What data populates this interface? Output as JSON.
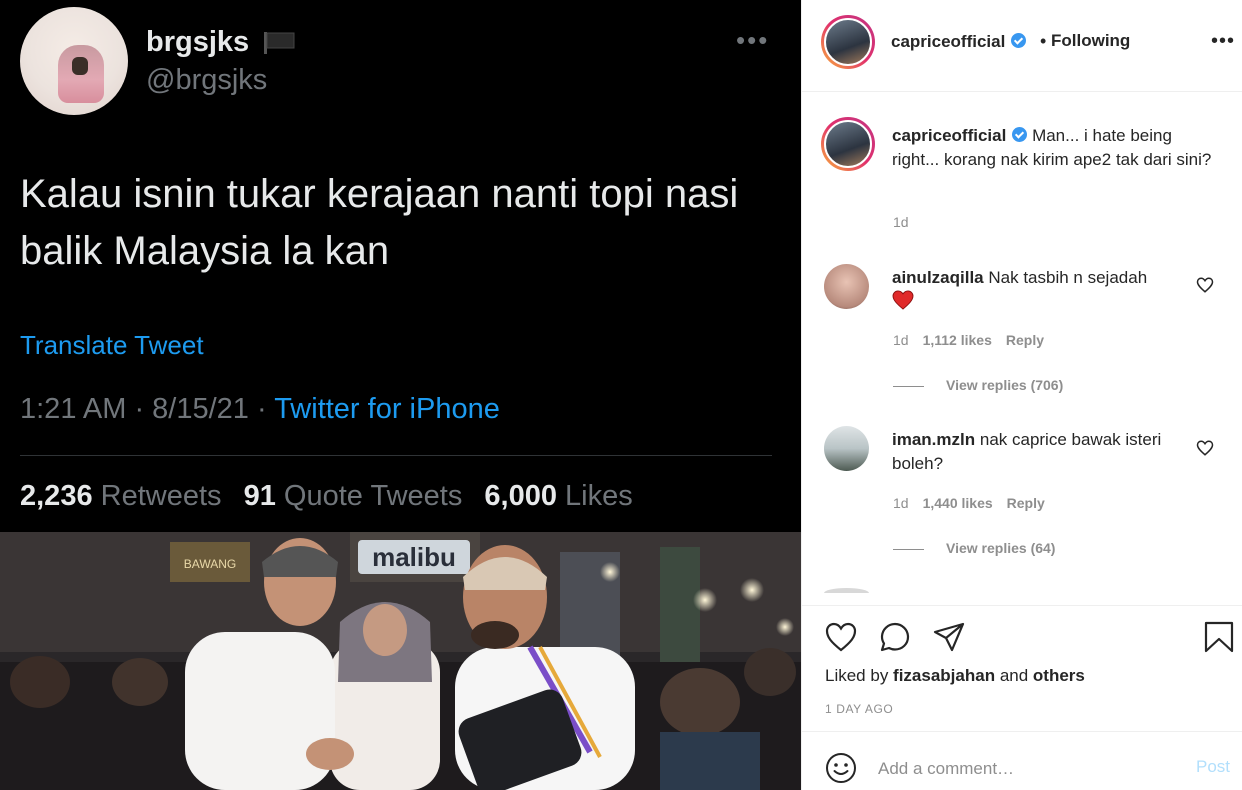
{
  "tweet": {
    "name": "brgsjks",
    "handle": "@brgsjks",
    "more": "•••",
    "text": "Kalau isnin tukar kerajaan nanti topi nasi balik Malaysia la kan",
    "translate": "Translate Tweet",
    "time": "1:21 AM · 8/15/21 · ",
    "source": "Twitter for iPhone",
    "retweets_count": "2,236",
    "retweets_label": "Retweets",
    "quotes_count": "91",
    "quotes_label": "Quote Tweets",
    "likes_count": "6,000",
    "likes_label": "Likes"
  },
  "photo": {
    "sign": "malibu",
    "sign2": "BAWANG"
  },
  "post": {
    "username": "capriceofficial",
    "follow_status": "Following",
    "more": "•••",
    "caption_user": "capriceofficial",
    "caption": "Man... i hate being right... korang nak kirim ape2 tak dari sini?",
    "caption_time": "1d"
  },
  "comments": [
    {
      "user": "ainulzaqilla",
      "text": "Nak tasbih n sejadah",
      "time": "1d",
      "likes": "1,112 likes",
      "reply": "Reply",
      "view_replies": "View replies (706)"
    },
    {
      "user": "iman.mzln",
      "text": "nak caprice bawak isteri boleh?",
      "time": "1d",
      "likes": "1,440 likes",
      "reply": "Reply",
      "view_replies": "View replies (64)"
    }
  ],
  "footer": {
    "liked_prefix": "Liked by ",
    "liked_user": "fizasabjahan",
    "liked_mid": " and ",
    "liked_others": "others",
    "ago": "1 DAY AGO",
    "add_comment_placeholder": "Add a comment…",
    "post_label": "Post"
  },
  "colors": {
    "twitter_blue": "#1d9bf0",
    "instagram_blue": "#3897f0",
    "heart_red": "#ed4956"
  }
}
